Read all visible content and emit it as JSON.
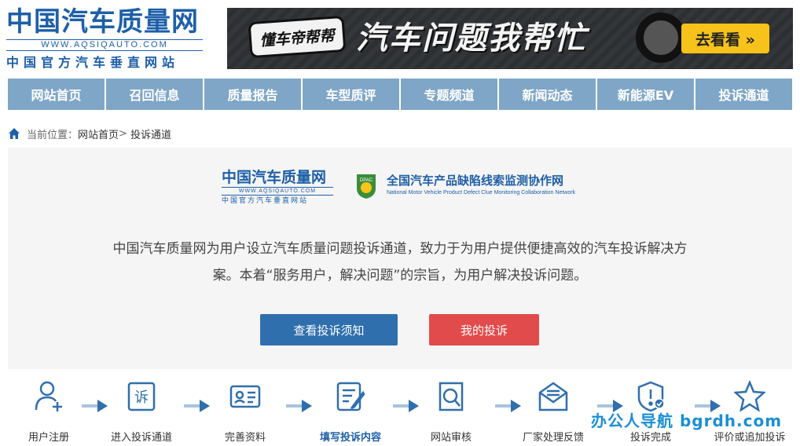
{
  "header": {
    "logo_title": "中国汽车质量网",
    "logo_url": "WWW.AQSIQAUTO.COM",
    "logo_sub": "中国官方汽车垂直网站",
    "banner": {
      "badge": "懂车帝帮帮",
      "title": "汽车问题我帮忙",
      "button": "去看看 »"
    }
  },
  "nav": {
    "items": [
      "网站首页",
      "召回信息",
      "质量报告",
      "车型质评",
      "专题频道",
      "新闻动态",
      "新能源EV",
      "投诉通道"
    ]
  },
  "breadcrumb": {
    "prefix": "当前位置：",
    "home": "网站首页",
    "sep": ">",
    "current": "投诉通道"
  },
  "panel": {
    "logo1": {
      "title": "中国汽车质量网",
      "url": "WWW.AQSIQAUTO.COM",
      "sub": "中国官方汽车垂直网站"
    },
    "logo2": {
      "badge": "DPAC",
      "title": "全国汽车产品缺陷线索监测协作网",
      "en": "National Motor Vehicle Product Defect Clue Monitoring Collaboration Network"
    },
    "intro_line1": "中国汽车质量网为用户设立汽车质量问题投诉通道，致力于为用户提供便捷高效的汽车投诉解决方",
    "intro_line2": "案。本着“服务用户，解决问题”的宗旨，为用户解决投诉问题。",
    "btn_notice": "查看投诉须知",
    "btn_mine": "我的投诉"
  },
  "steps": [
    {
      "label": "用户注册",
      "icon": "user-add-icon"
    },
    {
      "label": "进入投诉通道",
      "icon": "complaint-icon"
    },
    {
      "label": "完善资料",
      "icon": "id-card-icon"
    },
    {
      "label": "填写投诉内容",
      "icon": "edit-form-icon",
      "highlight": true
    },
    {
      "label": "网站审核",
      "icon": "search-review-icon"
    },
    {
      "label": "厂家处理反馈",
      "icon": "mail-icon"
    },
    {
      "label": "投诉完成",
      "icon": "shield-check-icon"
    },
    {
      "label": "评价或追加投诉",
      "icon": "star-icon"
    }
  ],
  "watermark": "办公人导航 bgrdh.com",
  "colors": {
    "brand_blue": "#1e5fa8",
    "nav_bg": "#7fa6c7",
    "btn_blue": "#2f6fae",
    "btn_red": "#e24b4b",
    "icon_blue": "#2f6fae"
  }
}
